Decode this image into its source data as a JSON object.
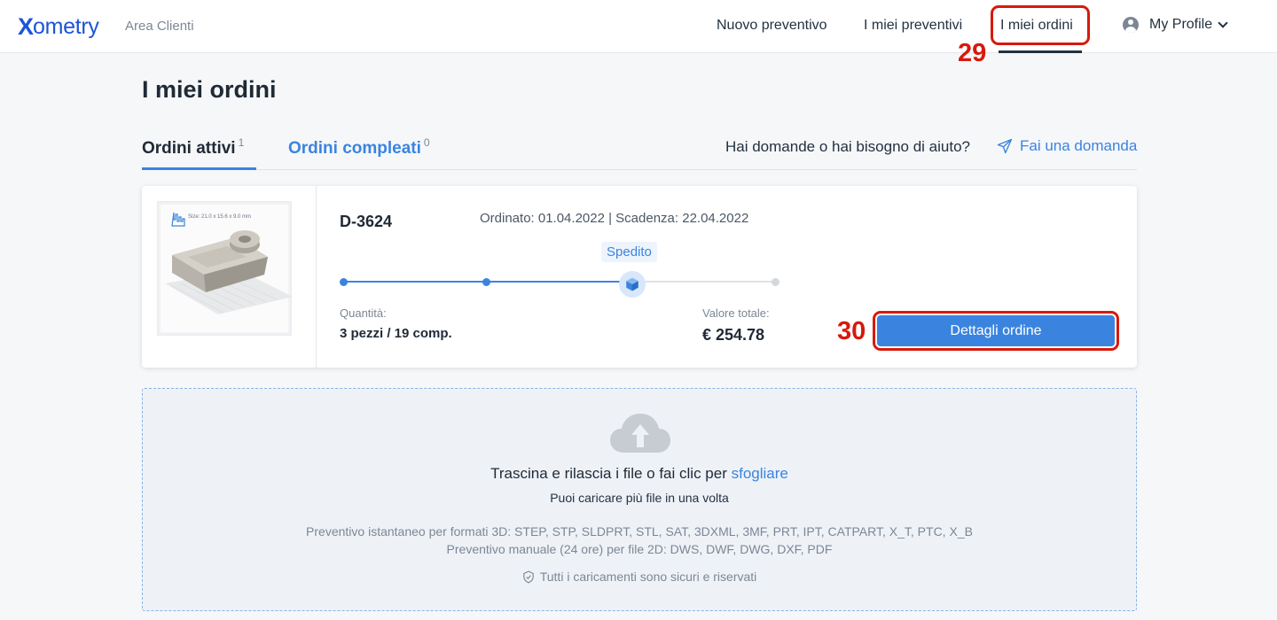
{
  "header": {
    "logo_x": "X",
    "logo_rest": "ometry",
    "area": "Area Clienti",
    "nav": {
      "new_quote": "Nuovo preventivo",
      "my_quotes": "I miei preventivi",
      "my_orders": "I miei ordini"
    },
    "profile": "My Profile"
  },
  "annotations": {
    "orders_number": "29",
    "button_number": "30"
  },
  "page": {
    "title": "I miei ordini",
    "tabs": {
      "active_label": "Ordini attivi",
      "active_count": "1",
      "completed_label": "Ordini compleati",
      "completed_count": "0"
    },
    "help_text": "Hai domande o hai bisogno di aiuto?",
    "ask_link": "Fai una domanda"
  },
  "order": {
    "thumbnail_size_text": "Size: 21.0 x 15.6 x 9.0 mm",
    "id": "D-3624",
    "dates": "Ordinato: 01.04.2022  |  Scadenza: 22.04.2022",
    "status": "Spedito",
    "progress": {
      "steps_total": 4,
      "current_step": 3
    },
    "quantity_label": "Quantità:",
    "quantity_value": "3 pezzi / 19 comp.",
    "total_label": "Valore totale:",
    "total_value": "€ 254.78",
    "details_button": "Dettagli ordine"
  },
  "upload": {
    "main_text": "Trascina e rilascia i file o fai clic per",
    "browse_link": "sfogliare",
    "sub_text": "Puoi caricare più file in una volta",
    "formats_3d": "Preventivo istantaneo per formati 3D: STEP, STP, SLDPRT, STL, SAT, 3DXML, 3MF, PRT, IPT, CATPART, X_T, PTC, X_B",
    "formats_2d": "Preventivo manuale (24 ore) per file 2D: DWS, DWF, DWG, DXF, PDF",
    "secure": "Tutti i caricamenti sono sicuri e riservati"
  },
  "colors": {
    "accent": "#3a84e0",
    "brand": "#1b54d9",
    "annotation": "#d61a0c"
  }
}
